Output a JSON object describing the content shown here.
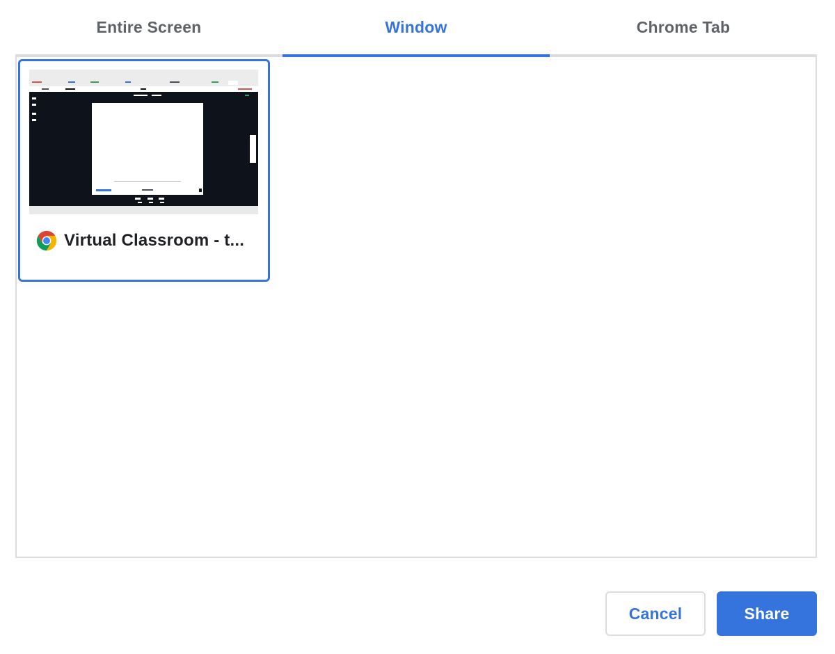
{
  "tabs": [
    {
      "label": "Entire Screen",
      "active": false
    },
    {
      "label": "Window",
      "active": true
    },
    {
      "label": "Chrome Tab",
      "active": false
    }
  ],
  "windows": [
    {
      "title": "Virtual Classroom - t...",
      "app_icon": "chrome-icon",
      "selected": true
    }
  ],
  "buttons": {
    "cancel_label": "Cancel",
    "share_label": "Share"
  },
  "colors": {
    "accent": "#3574dc",
    "border": "#dadce0",
    "tab_inactive": "#5f6368",
    "title_text": "#202124",
    "thumbnail_dark": "#0e131b"
  }
}
